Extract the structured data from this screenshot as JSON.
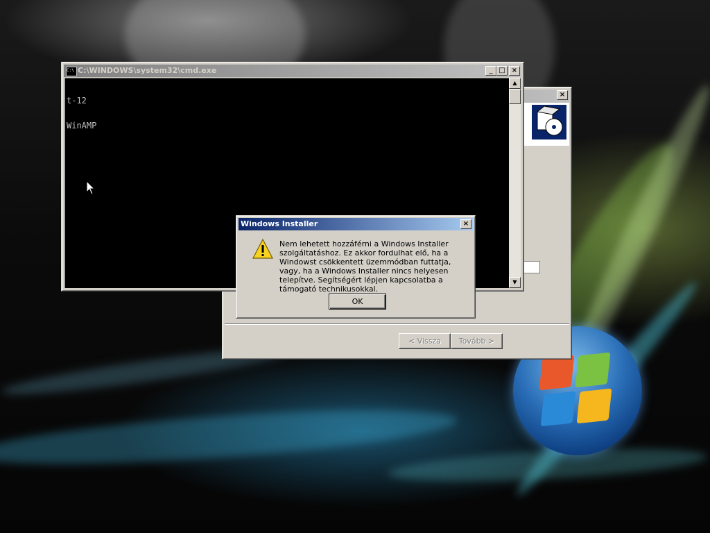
{
  "cmd_window": {
    "title": "C:\\WINDOWS\\system32\\cmd.exe",
    "lines": [
      "t-12",
      "WinAMP"
    ],
    "controls": {
      "minimize": "_",
      "maximize": "□",
      "close": "×"
    }
  },
  "setup_window": {
    "close": "×",
    "back_label": "< Vissza",
    "next_label": "Tovább >"
  },
  "installer_dialog": {
    "title": "Windows Installer",
    "close": "×",
    "message": "Nem lehetett hozzáférni a Windows Installer szolgáltatáshoz. Ez akkor fordulhat elő, ha a Windowst csökkentett üzemmódban futtatja, vagy, ha a Windows Installer nincs helyesen telepítve. Segítségért lépjen kapcsolatba a támogató technikusokkal.",
    "ok_label": "OK",
    "icon": "warning-icon"
  },
  "colors": {
    "title_active_start": "#0a246a",
    "title_active_end": "#a6caf0",
    "window_face": "#d4d0c8",
    "console_bg": "#000000",
    "console_fg": "#c0c0c0"
  }
}
